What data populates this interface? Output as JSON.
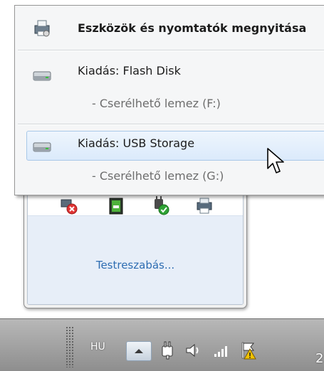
{
  "menu": {
    "items": [
      {
        "label": "Eszközök és nyomtatók megnyitása",
        "icon": "devices-printers-icon"
      },
      {
        "label": "Kiadás: Flash Disk",
        "sub": "- Cserélhető lemez (F:)",
        "icon": "drive-icon"
      },
      {
        "label": "Kiadás: USB Storage",
        "sub": "- Cserélhető lemez (G:)",
        "icon": "drive-icon",
        "highlighted": true
      }
    ]
  },
  "tray_popup": {
    "icons": [
      "network-error-icon",
      "battery-green-icon",
      "power-plug-check-icon",
      "printer-icon"
    ],
    "customize_label": "Testreszabás..."
  },
  "taskbar": {
    "language": "HU",
    "clock_partial": "2",
    "icons": [
      "show-hidden-icons-button",
      "power-plug-icon",
      "speaker-icon",
      "signal-bars-icon",
      "action-center-flag-icon"
    ]
  },
  "colors": {
    "link": "#2e6db2",
    "highlight_border": "#a8c8e8"
  }
}
